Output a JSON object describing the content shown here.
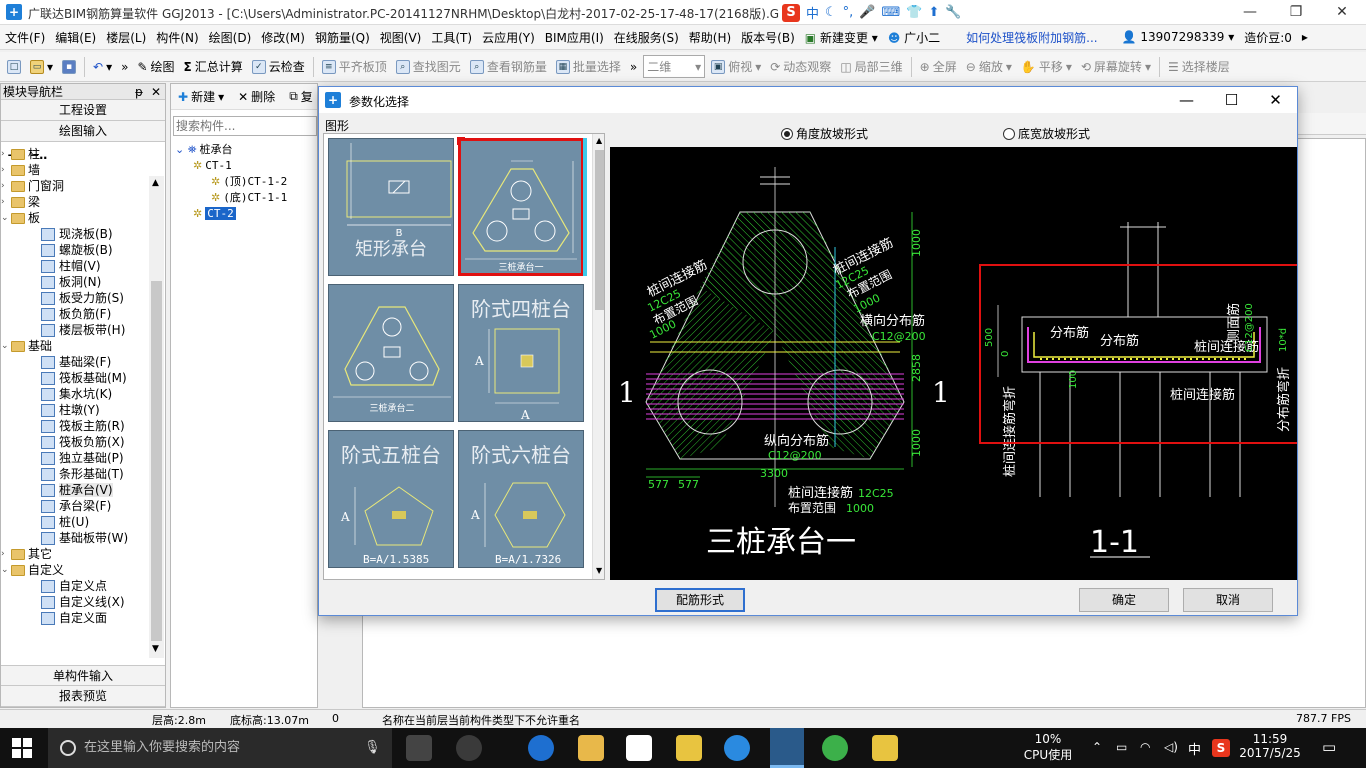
{
  "window": {
    "title": "广联达BIM钢筋算量软件 GGJ2013 - [C:\\Users\\Administrator.PC-20141127NRHM\\Desktop\\白龙村-2017-02-25-17-48-17(2168版).G",
    "ime": {
      "mode": "中"
    }
  },
  "menubar": {
    "items": [
      "文件(F)",
      "编辑(E)",
      "楼层(L)",
      "构件(N)",
      "绘图(D)",
      "修改(M)",
      "钢筋量(Q)",
      "视图(V)",
      "工具(T)",
      "云应用(Y)",
      "BIM应用(I)",
      "在线服务(S)",
      "帮助(H)",
      "版本号(B)",
      "新建变更",
      "广小二",
      "如何处理筏板附加钢筋...",
      "13907298339",
      "造价豆:0"
    ]
  },
  "toolbar": {
    "draw": "绘图",
    "sum": "汇总计算",
    "cloud_check": "云检查",
    "flat_top": "平齐板顶",
    "find": "查找图元",
    "view_rebar": "查看钢筋量",
    "batch_select": "批量选择",
    "view_mode": "二维",
    "top_view": "俯视",
    "dynamic": "动态观察",
    "local3d": "局部三维",
    "fullscreen": "全屏",
    "zoom": "缩放",
    "pan": "平移",
    "rotate": "屏幕旋转",
    "select_floor": "选择楼层"
  },
  "nav": {
    "header": "模块导航栏",
    "project_settings": "工程设置",
    "drawing_input": "绘图输入",
    "single_input": "单构件输入",
    "report_preview": "报表预览",
    "tree": [
      {
        "label": "柱",
        "kind": "folder",
        "depth": 1,
        "expand": ">"
      },
      {
        "label": "墙",
        "kind": "folder",
        "depth": 1,
        "expand": ">"
      },
      {
        "label": "门窗洞",
        "kind": "folder",
        "depth": 1,
        "expand": ">"
      },
      {
        "label": "梁",
        "kind": "folder",
        "depth": 1,
        "expand": ">"
      },
      {
        "label": "板",
        "kind": "folder",
        "depth": 1,
        "expand": "v"
      },
      {
        "label": "现浇板(B)",
        "kind": "item",
        "depth": 2
      },
      {
        "label": "螺旋板(B)",
        "kind": "item",
        "depth": 2
      },
      {
        "label": "柱帽(V)",
        "kind": "item",
        "depth": 2
      },
      {
        "label": "板洞(N)",
        "kind": "item",
        "depth": 2
      },
      {
        "label": "板受力筋(S)",
        "kind": "item",
        "depth": 2
      },
      {
        "label": "板负筋(F)",
        "kind": "item",
        "depth": 2
      },
      {
        "label": "楼层板带(H)",
        "kind": "item",
        "depth": 2
      },
      {
        "label": "基础",
        "kind": "folder",
        "depth": 1,
        "expand": "v"
      },
      {
        "label": "基础梁(F)",
        "kind": "item",
        "depth": 2
      },
      {
        "label": "筏板基础(M)",
        "kind": "item",
        "depth": 2
      },
      {
        "label": "集水坑(K)",
        "kind": "item",
        "depth": 2
      },
      {
        "label": "柱墩(Y)",
        "kind": "item",
        "depth": 2
      },
      {
        "label": "筏板主筋(R)",
        "kind": "item",
        "depth": 2
      },
      {
        "label": "筏板负筋(X)",
        "kind": "item",
        "depth": 2
      },
      {
        "label": "独立基础(P)",
        "kind": "item",
        "depth": 2
      },
      {
        "label": "条形基础(T)",
        "kind": "item",
        "depth": 2
      },
      {
        "label": "桩承台(V)",
        "kind": "item",
        "depth": 2,
        "selected": true
      },
      {
        "label": "承台梁(F)",
        "kind": "item",
        "depth": 2
      },
      {
        "label": "桩(U)",
        "kind": "item",
        "depth": 2
      },
      {
        "label": "基础板带(W)",
        "kind": "item",
        "depth": 2
      },
      {
        "label": "其它",
        "kind": "folder",
        "depth": 1,
        "expand": ">"
      },
      {
        "label": "自定义",
        "kind": "folder",
        "depth": 1,
        "expand": "v"
      },
      {
        "label": "自定义点",
        "kind": "item",
        "depth": 2
      },
      {
        "label": "自定义线(X)",
        "kind": "item",
        "depth": 2
      },
      {
        "label": "自定义面",
        "kind": "item",
        "depth": 2
      }
    ]
  },
  "component_panel": {
    "new_label": "新建",
    "delete_label": "删除",
    "copy_label": "复",
    "search_placeholder": "搜索构件...",
    "tree": [
      {
        "label": "桩承台",
        "depth": 0
      },
      {
        "label": "CT-1",
        "depth": 1
      },
      {
        "label": "(顶)CT-1-2",
        "depth": 2
      },
      {
        "label": "(底)CT-1-1",
        "depth": 2
      },
      {
        "label": "CT-2",
        "depth": 1,
        "selected": true
      }
    ]
  },
  "dialog": {
    "title": "参数化选择",
    "shape_label": "图形",
    "shapes": [
      {
        "name": "矩形承台",
        "dims": [
          "B"
        ]
      },
      {
        "name": "三桩承台一",
        "selected": true
      },
      {
        "name": "三桩承台二"
      },
      {
        "name": "阶式四桩台",
        "dims": [
          "A",
          "A"
        ]
      },
      {
        "name": "阶式五桩台",
        "dims": [
          "A",
          "B=A/1.5385"
        ]
      },
      {
        "name": "阶式六桩台",
        "dims": [
          "A",
          "B=A/1.7326"
        ]
      }
    ],
    "radios": [
      {
        "label": "角度放坡形式",
        "checked": true
      },
      {
        "label": "底宽放坡形式",
        "checked": false
      }
    ],
    "buttons": {
      "rebar_form": "配筋形式",
      "ok": "确定",
      "cancel": "取消"
    },
    "drawing": {
      "plan_title": "三桩承台一",
      "section_title": "1-1",
      "section_mark": "1",
      "labels": {
        "pile_connect": "桩间连接筋",
        "layout_range": "布置范围",
        "c12c25": "12C25",
        "v1000": "1000",
        "horizontal_dist": "横向分布筋",
        "c12_200": "C12@200",
        "longitudinal_dist": "纵向分布筋",
        "dim_3300": "3300",
        "dim_577": "577",
        "dim_2858": "2858",
        "dist_bar": "分布筋",
        "side_bar": "侧面筋",
        "c12_200b": "C12@200",
        "pile_connect_bend": "桩间连接筋弯折",
        "dist_bar_bend": "分布筋弯折",
        "dim_500": "500",
        "dim_0": "0",
        "dim_100": "100",
        "dim_10d": "10*d"
      }
    }
  },
  "status": {
    "floor_height": "层高:2.8m",
    "bottom_elev": "底标高:13.07m",
    "zero": "0",
    "message": "名称在当前层当前构件类型下不允许重名",
    "fps": "787.7 FPS"
  },
  "taskbar": {
    "search_placeholder": "在这里输入你要搜索的内容",
    "cpu_percent": "10%",
    "cpu_label": "CPU使用",
    "ime": "中",
    "time": "11:59",
    "date": "2017/5/25"
  },
  "colors": {
    "accent": "#1e7fd8",
    "selected_red": "#e01010",
    "thumb_bg": "#6f8ea6",
    "cad_bg": "#000000",
    "cad_green": "#39e639",
    "cad_magenta": "#e040e0",
    "cad_yellow": "#f0f040"
  }
}
